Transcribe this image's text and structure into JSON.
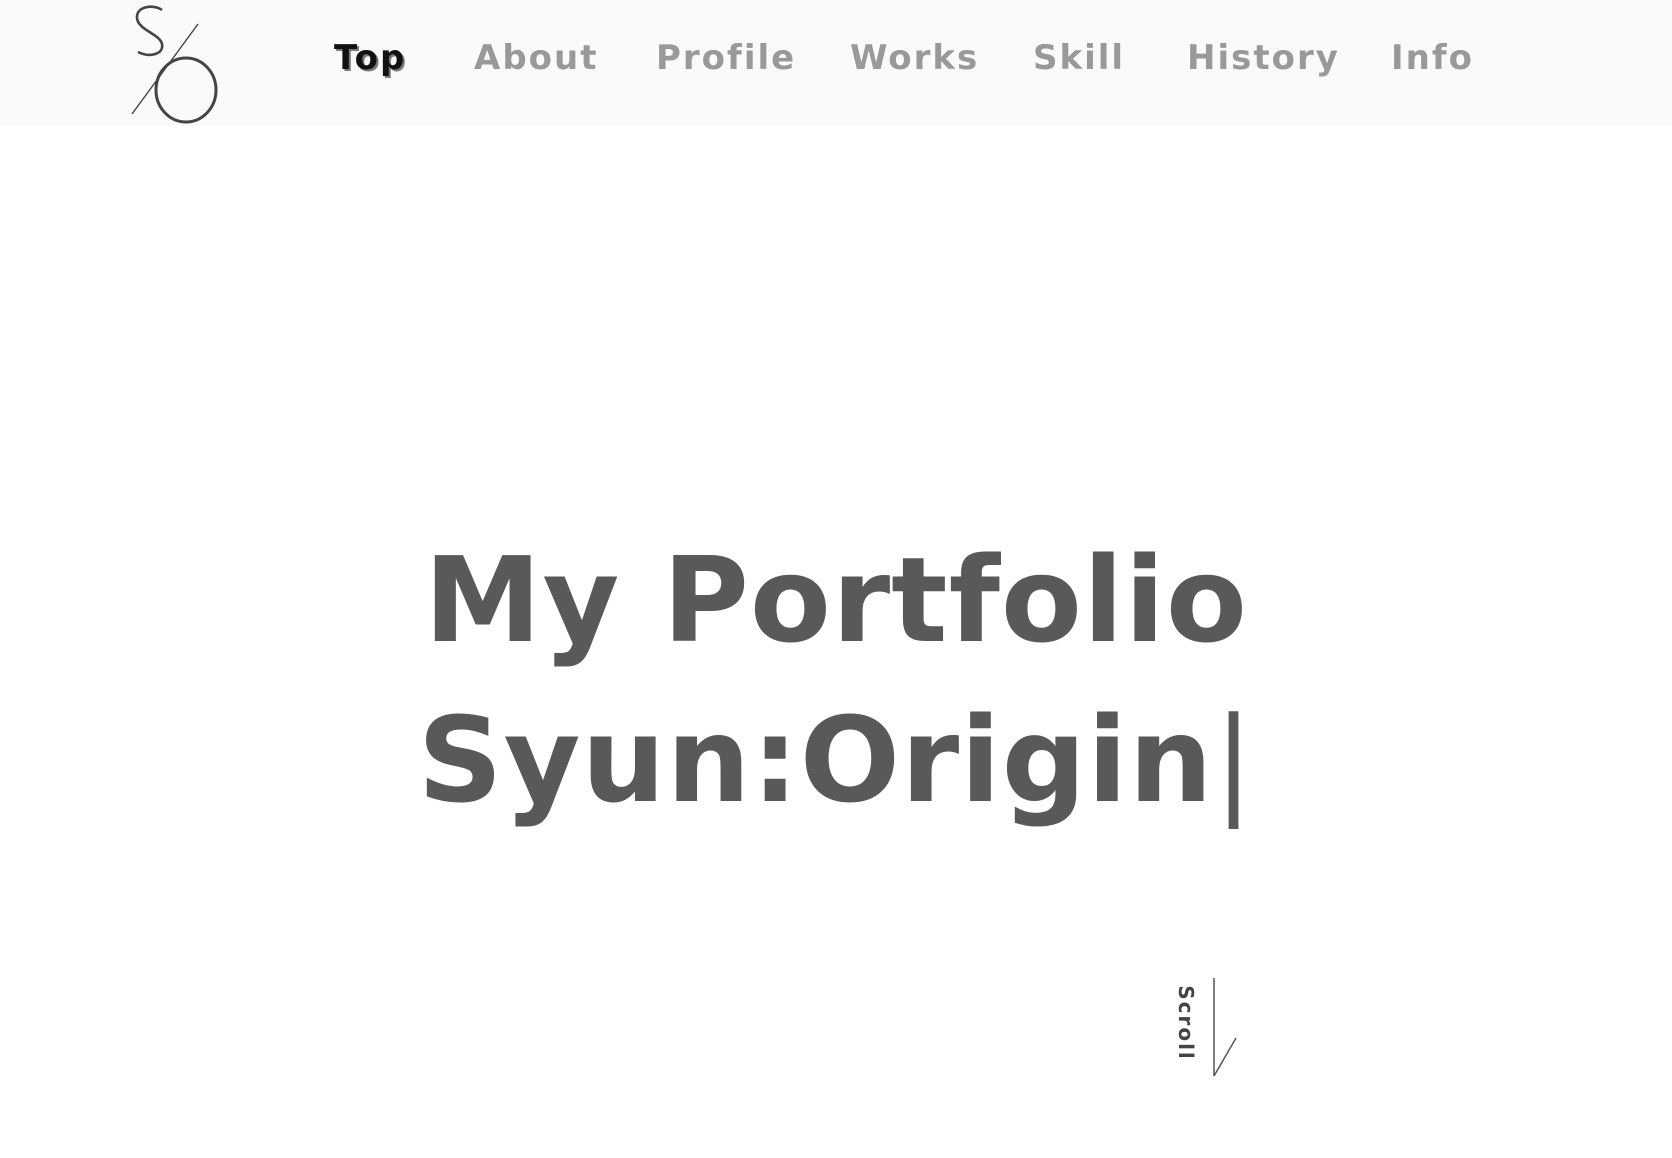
{
  "header": {
    "logo_text": "S/O",
    "nav": [
      {
        "label": "Top",
        "active": true
      },
      {
        "label": "About",
        "active": false
      },
      {
        "label": "Profile",
        "active": false
      },
      {
        "label": "Works",
        "active": false
      },
      {
        "label": "Skill",
        "active": false
      },
      {
        "label": "History",
        "active": false
      },
      {
        "label": "Info",
        "active": false
      }
    ]
  },
  "hero": {
    "line1": "My Portfolio",
    "line2": "Syun:Origin",
    "caret": "|"
  },
  "scroll": {
    "label": "Scroll",
    "icon": "arrow-down-icon"
  },
  "colors": {
    "text": "#595959",
    "nav_inactive": "#999999",
    "nav_active": "#111111",
    "header_bg": "#fafafa"
  }
}
